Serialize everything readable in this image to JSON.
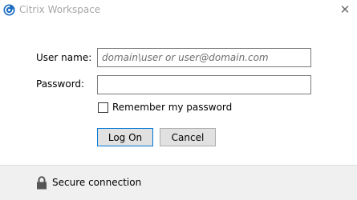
{
  "window": {
    "title": "Citrix Workspace",
    "app_icon": "citrix-swirl-icon",
    "close_icon": "close-icon",
    "close_glyph": "✕"
  },
  "form": {
    "username_label": "User name:",
    "username_value": "",
    "username_placeholder": "domain\\user or user@domain.com",
    "password_label": "Password:",
    "password_value": "",
    "password_placeholder": "",
    "remember_label": "Remember my password",
    "remember_checked": false
  },
  "buttons": {
    "logon_label": "Log On",
    "cancel_label": "Cancel"
  },
  "footer": {
    "text": "Secure connection",
    "icon": "lock-icon"
  },
  "colors": {
    "accent": "#0078d7",
    "citrix_blue": "#1e6fc2",
    "footer_bg": "#f0f0f0",
    "title_text": "#a6a6a6"
  }
}
